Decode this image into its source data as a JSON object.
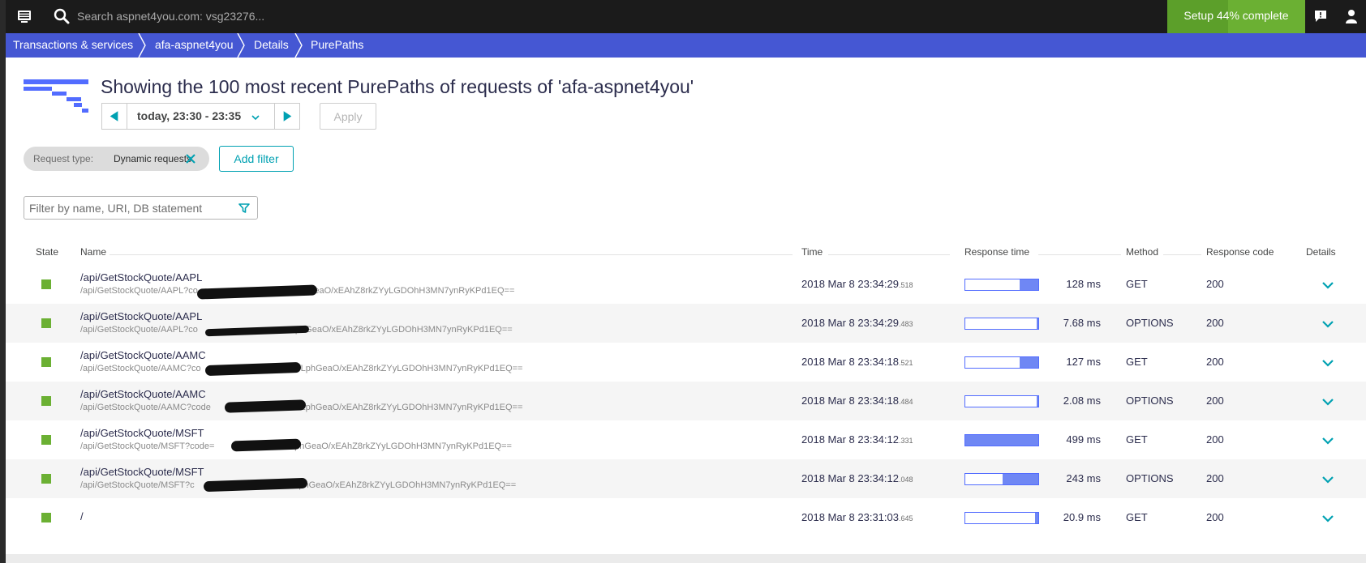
{
  "topbar": {
    "search_placeholder": "Search aspnet4you.com: vsg23276...",
    "setup_label": "Setup 44% complete",
    "setup_progress_percent": 44,
    "setup_color": "#6bb033"
  },
  "breadcrumb": {
    "items": [
      "Transactions & services",
      "afa-aspnet4you",
      "Details",
      "PurePaths"
    ],
    "color": "#4557d3"
  },
  "header": {
    "title": "Showing the 100 most recent PurePaths of requests of 'afa-aspnet4you'"
  },
  "timeframe": {
    "label": "today, 23:30 - 23:35",
    "apply_label": "Apply",
    "accent": "#00a1b2"
  },
  "filters": {
    "chip_key": "Request type:",
    "chip_value": "Dynamic requests",
    "add_filter_label": "Add filter",
    "name_filter_placeholder": "Filter by name, URI, DB statement"
  },
  "table": {
    "headers": {
      "state": "State",
      "name": "Name",
      "time": "Time",
      "response_time": "Response time",
      "method": "Method",
      "response_code": "Response code",
      "details": "Details"
    },
    "rows": [
      {
        "name": "/api/GetStockQuote/AAPL",
        "uri": "/api/GetStockQuote/AAPL?co",
        "uri_tail": "vfLphGeaO/xEAhZ8rkZYyLGDOhH3MN7ynRyKPd1EQ==",
        "time": "2018 Mar 8 23:34:29",
        "ms": ".518",
        "response_time": "128 ms",
        "bar_fraction": 0.26,
        "method": "GET",
        "code": "200"
      },
      {
        "name": "/api/GetStockQuote/AAPL",
        "uri": "/api/GetStockQuote/AAPL?co",
        "uri_tail": "phGeaO/xEAhZ8rkZYyLGDOhH3MN7ynRyKPd1EQ==",
        "time": "2018 Mar 8 23:34:29",
        "ms": ".483",
        "response_time": "7.68 ms",
        "bar_fraction": 0.02,
        "method": "OPTIONS",
        "code": "200"
      },
      {
        "name": "/api/GetStockQuote/AAMC",
        "uri": "/api/GetStockQuote/AAMC?co",
        "uri_tail": "P6vfLphGeaO/xEAhZ8rkZYyLGDOhH3MN7ynRyKPd1EQ==",
        "time": "2018 Mar 8 23:34:18",
        "ms": ".521",
        "response_time": "127 ms",
        "bar_fraction": 0.25,
        "method": "GET",
        "code": "200"
      },
      {
        "name": "/api/GetStockQuote/AAMC",
        "uri": "/api/GetStockQuote/AAMC?code",
        "uri_tail": "6vfLphGeaO/xEAhZ8rkZYyLGDOhH3MN7ynRyKPd1EQ==",
        "time": "2018 Mar 8 23:34:18",
        "ms": ".484",
        "response_time": "2.08 ms",
        "bar_fraction": 0.005,
        "method": "OPTIONS",
        "code": "200"
      },
      {
        "name": "/api/GetStockQuote/MSFT",
        "uri": "/api/GetStockQuote/MSFT?code=",
        "uri_tail": "6vfLphGeaO/xEAhZ8rkZYyLGDOhH3MN7ynRyKPd1EQ==",
        "time": "2018 Mar 8 23:34:12",
        "ms": ".331",
        "response_time": "499 ms",
        "bar_fraction": 1.0,
        "method": "GET",
        "code": "200"
      },
      {
        "name": "/api/GetStockQuote/MSFT",
        "uri": "/api/GetStockQuote/MSFT?c",
        "uri_tail": "6vfLphGeaO/xEAhZ8rkZYyLGDOhH3MN7ynRyKPd1EQ==",
        "time": "2018 Mar 8 23:34:12",
        "ms": ".048",
        "response_time": "243 ms",
        "bar_fraction": 0.49,
        "method": "OPTIONS",
        "code": "200"
      },
      {
        "name": "/",
        "uri": "",
        "uri_tail": "",
        "time": "2018 Mar 8 23:31:03",
        "ms": ".645",
        "response_time": "20.9 ms",
        "bar_fraction": 0.04,
        "method": "GET",
        "code": "200"
      }
    ],
    "state_color": "#6bb033",
    "bar_color": "#6f87f4"
  }
}
